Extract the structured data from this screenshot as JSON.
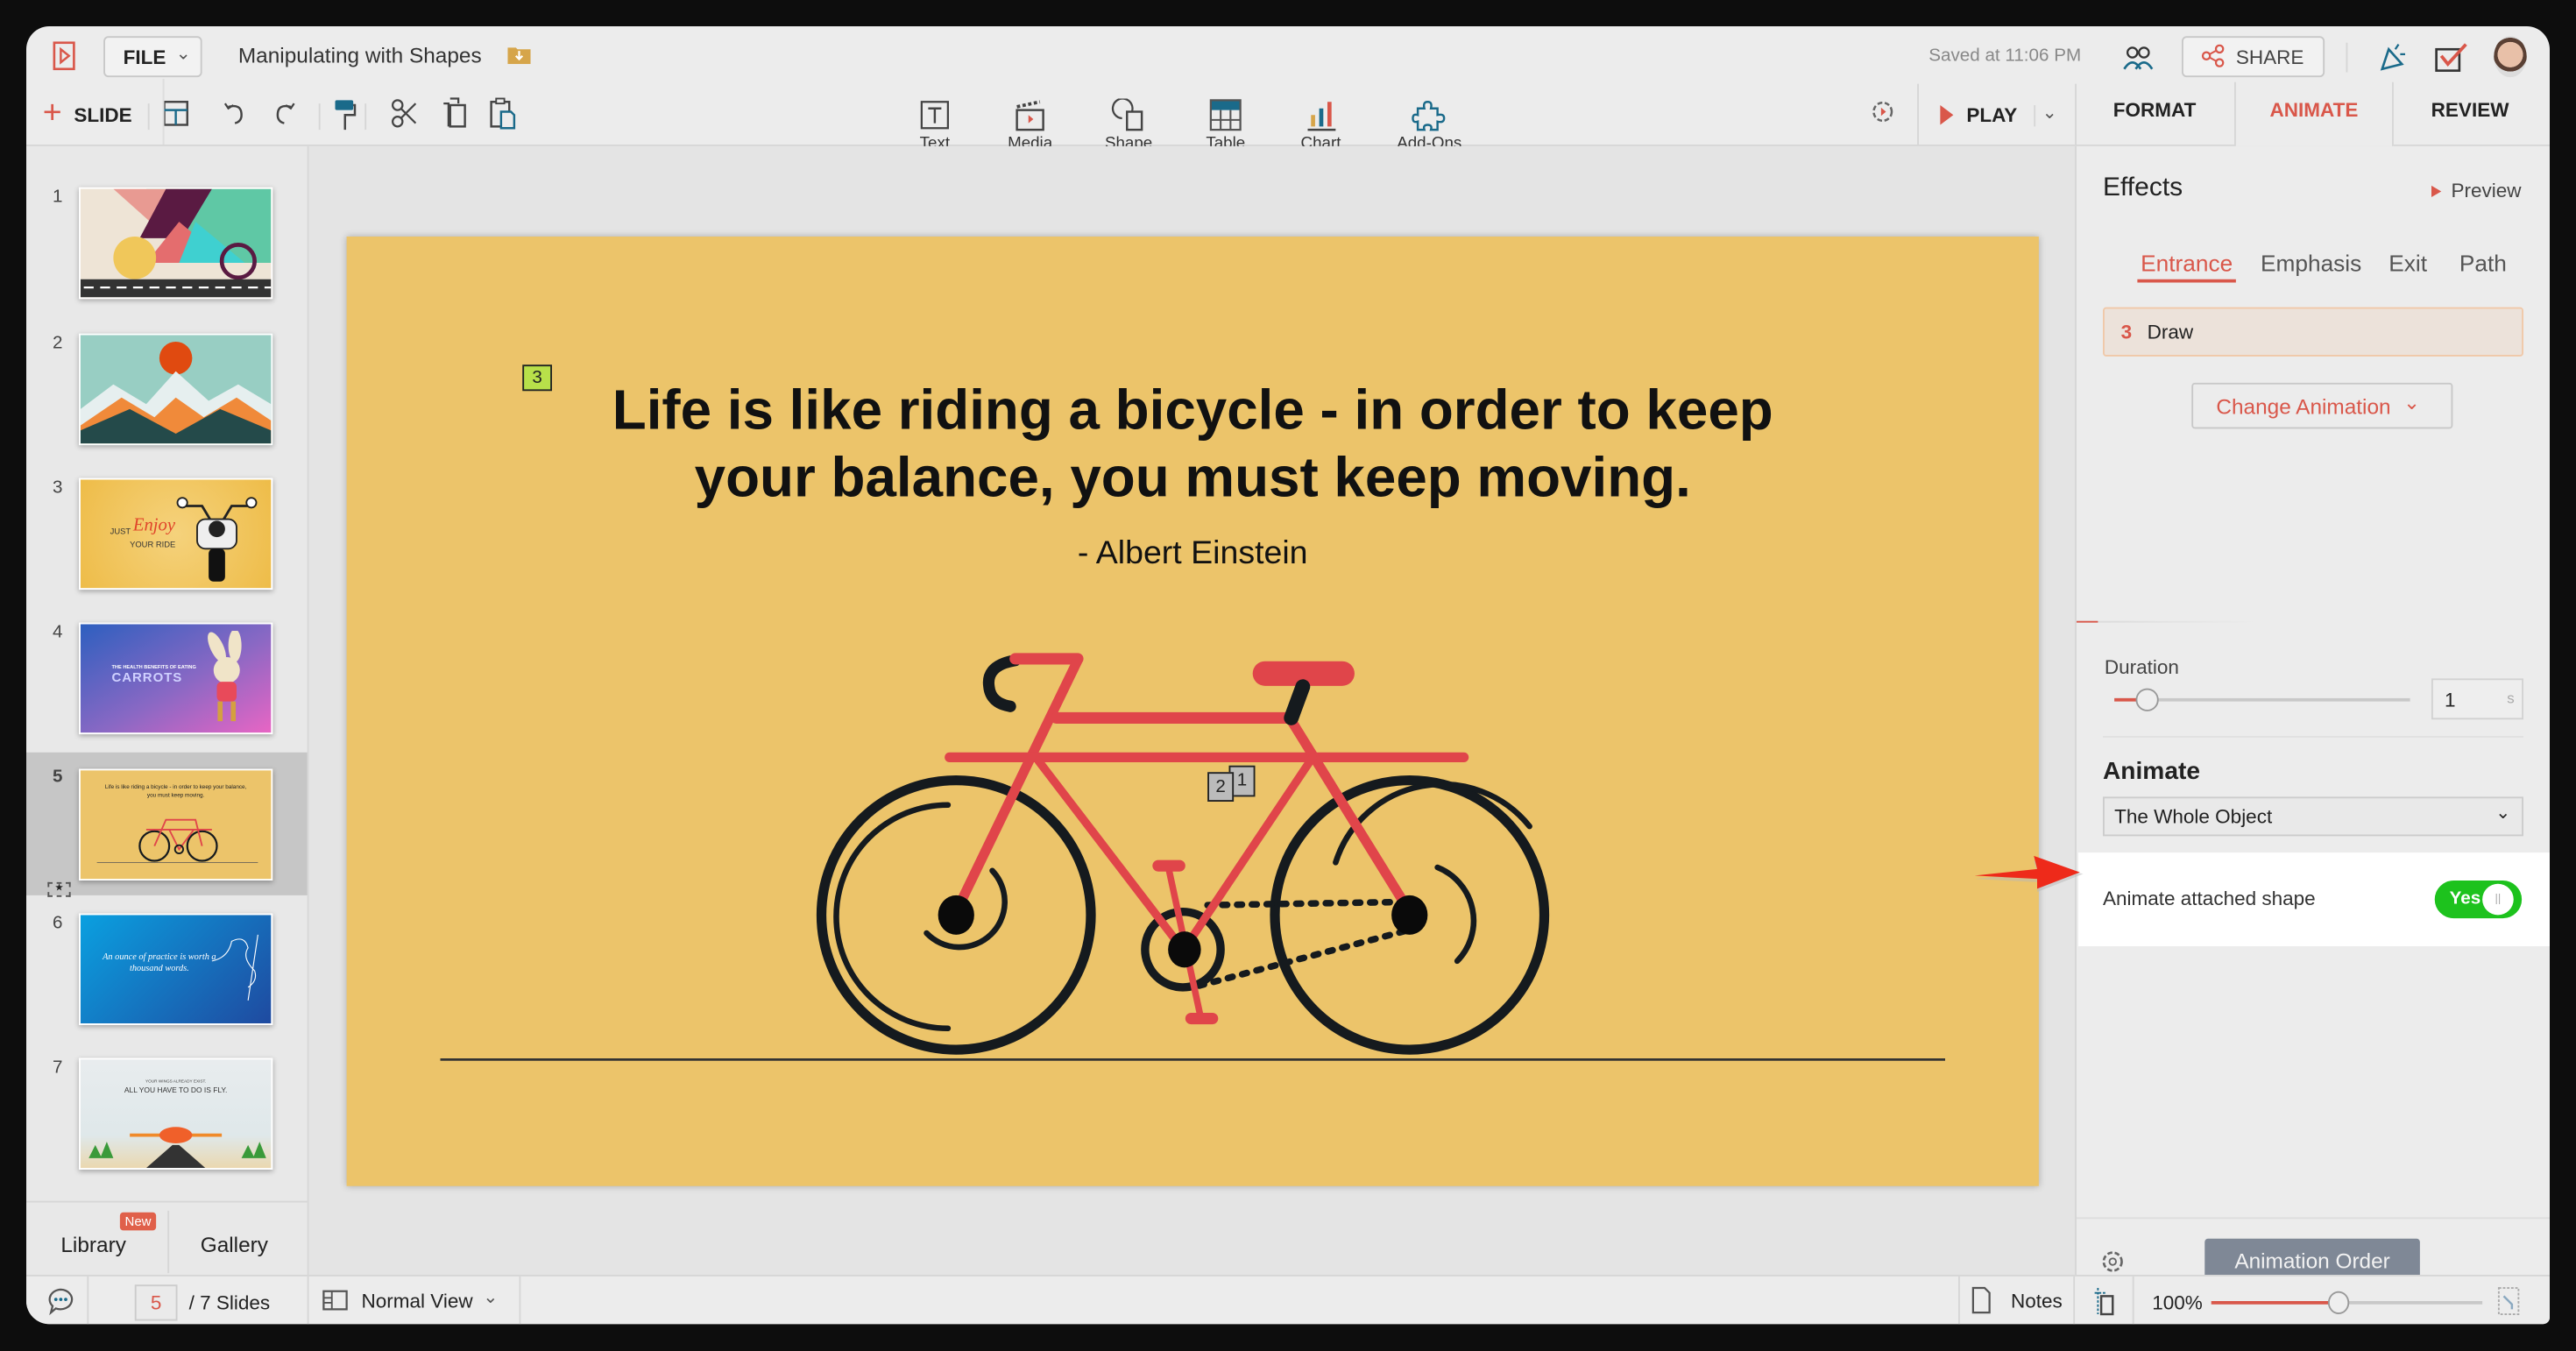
{
  "app": {
    "file_menu": "FILE",
    "doc_title": "Manipulating with Shapes",
    "saved_status": "Saved at 11:06 PM",
    "share_label": "SHARE"
  },
  "toolbar": {
    "slide_label": "SLIDE",
    "insert": [
      {
        "label": "Text",
        "icon": "text-box-icon"
      },
      {
        "label": "Media",
        "icon": "media-clapper-icon"
      },
      {
        "label": "Shape",
        "icon": "shape-icon"
      },
      {
        "label": "Table",
        "icon": "table-icon"
      },
      {
        "label": "Chart",
        "icon": "bar-chart-icon"
      },
      {
        "label": "Add-Ons",
        "icon": "puzzle-icon"
      }
    ],
    "play_label": "PLAY"
  },
  "panel_tabs": [
    {
      "label": "FORMAT"
    },
    {
      "label": "ANIMATE",
      "active": true
    },
    {
      "label": "REVIEW"
    }
  ],
  "slides": {
    "items": [
      {
        "number": "1"
      },
      {
        "number": "2"
      },
      {
        "number": "3",
        "text_a": "JUST",
        "text_b": "Enjoy",
        "text_c": "YOUR RIDE"
      },
      {
        "number": "4",
        "text_a": "THE HEALTH BENEFITS OF EATING",
        "text_b": "CARROTS"
      },
      {
        "number": "5",
        "selected": true,
        "text_a": "Life is like riding a bicycle - in order to keep your balance, you must keep moving."
      },
      {
        "number": "6",
        "text_a": "An ounce of practice is worth a thousand words."
      },
      {
        "number": "7",
        "text_a": "YOUR WINGS ALREADY EXIST.",
        "text_b": "ALL YOU HAVE TO DO IS FLY."
      }
    ],
    "library_label": "Library",
    "library_badge": "New",
    "gallery_label": "Gallery"
  },
  "slide": {
    "quote_line1": "Life is like riding a bicycle - in order to keep",
    "quote_line2": "your balance, you must keep moving.",
    "author": "- Albert Einstein",
    "badge_text": "3",
    "badge_shape_a": "2",
    "badge_shape_b": "1",
    "colors": {
      "background": "#ecc46a",
      "frame": "#e0454a",
      "wheels": "#151a1e"
    }
  },
  "animate_panel": {
    "effects_title": "Effects",
    "preview_label": "Preview",
    "effect_tabs": [
      {
        "label": "Entrance",
        "active": true
      },
      {
        "label": "Emphasis"
      },
      {
        "label": "Exit"
      },
      {
        "label": "Path"
      }
    ],
    "applied": {
      "order": "3",
      "name": "Draw"
    },
    "change_animation_label": "Change Animation",
    "duration_label": "Duration",
    "duration_value": "1",
    "duration_unit": "s",
    "animate_title": "Animate",
    "animate_select": "The Whole Object",
    "attached_label": "Animate attached shape",
    "attached_toggle": "Yes",
    "attached_on": true,
    "animation_order_label": "Animation Order",
    "accent": "#d9574a",
    "toggle_color": "#1dc21d"
  },
  "statusbar": {
    "current_slide": "5",
    "total_slides": "/ 7 Slides",
    "view_label": "Normal View",
    "notes_label": "Notes",
    "zoom": "100%",
    "zoom_percent": 100
  }
}
